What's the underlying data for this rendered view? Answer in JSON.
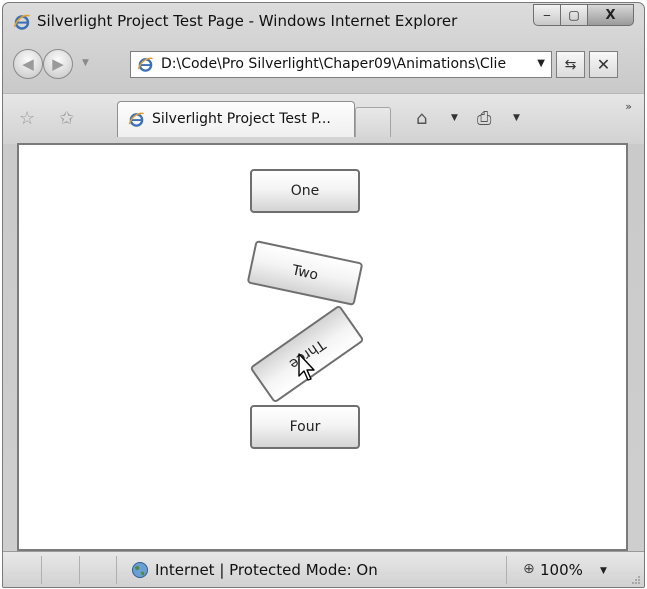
{
  "window": {
    "title": "Silverlight Project Test Page - Windows Internet Explorer",
    "min_glyph": "‒",
    "max_glyph": "▢",
    "close_glyph": "X"
  },
  "navigation": {
    "back_glyph": "◀",
    "forward_glyph": "▶",
    "recent_glyph": "▼",
    "address": "D:\\Code\\Pro Silverlight\\Chaper09\\Animations\\Clie",
    "address_dropdown_glyph": "▼",
    "refresh_glyph": "⇆",
    "stop_glyph": "✕"
  },
  "tabs": {
    "favorites_glyph": "☆",
    "add_favorites_glyph": "✩",
    "active_tab_label": "Silverlight Project Test P...",
    "home_glyph": "⌂",
    "print_glyph": "⎙",
    "dropdown_glyph": "▼",
    "more_glyph": "»"
  },
  "content": {
    "buttons": [
      {
        "label": "One",
        "rotation_deg": 0
      },
      {
        "label": "Two",
        "rotation_deg": 12
      },
      {
        "label": "Three",
        "rotation_deg": 145
      },
      {
        "label": "Four",
        "rotation_deg": 0
      }
    ]
  },
  "statusbar": {
    "zone_text": "Internet | Protected Mode: On",
    "zoom_glyph": "⊕",
    "zoom_text": "100%",
    "zoom_dropdown_glyph": "▼"
  },
  "colors": {
    "chrome": "#d4d4d4",
    "page_background": "#ffffff",
    "button_border": "#6f6f6f",
    "ie_logo_blue": "#3b6fb6"
  }
}
